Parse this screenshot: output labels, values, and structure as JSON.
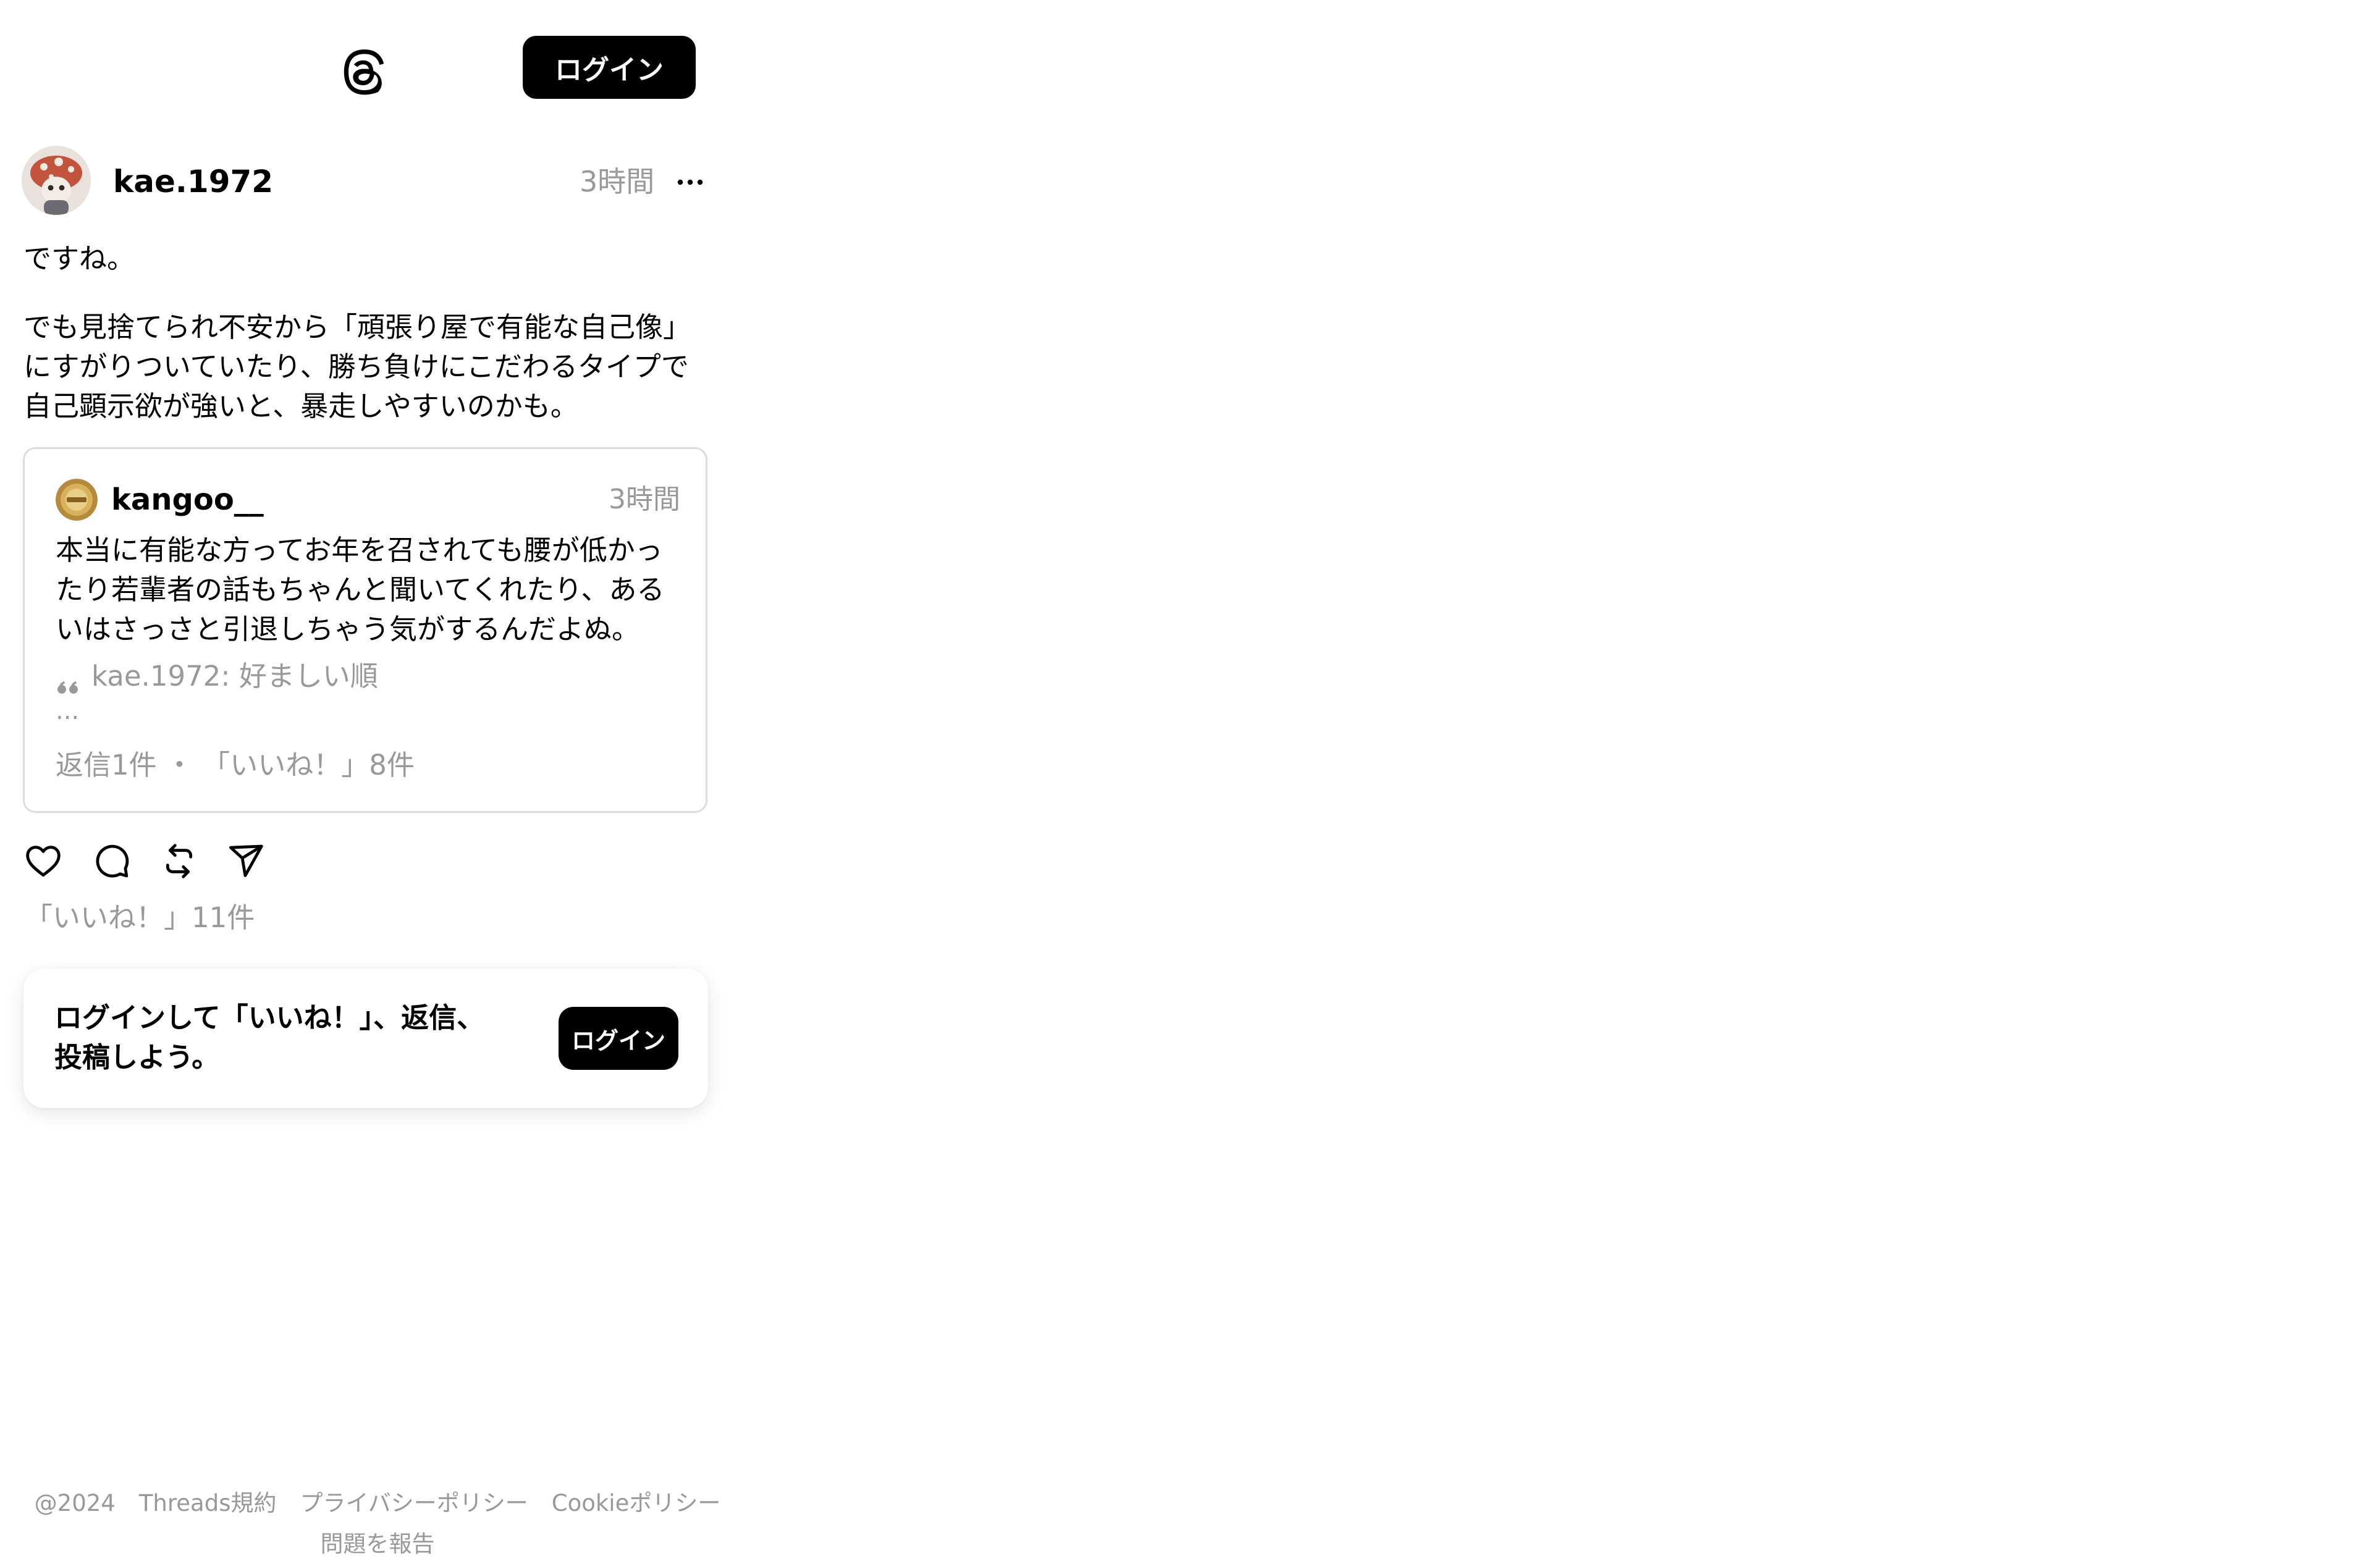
{
  "header": {
    "logo_icon": "threads-logo-icon",
    "login_label": "ログイン"
  },
  "post": {
    "avatar_icon": "mushroom-avatar",
    "username": "kae.1972",
    "time": "3時間",
    "more_icon": "more-horizontal-icon",
    "paragraph1": "ですね。",
    "paragraph2": "でも見捨てられ不安から「頑張り屋で有能な自己像」\nにすがりついていたり、勝ち負けにこだわるタイプで\n自己顕示欲が強いと、暴走しやすいのかも。"
  },
  "quote": {
    "avatar_icon": "badge-avatar",
    "username": "kangoo__",
    "time": "3時間",
    "text": "本当に有能な方ってお年を召されても腰が低かっ\nたり若輩者の話もちゃんと聞いてくれたり、ある\nいはさっさと引退しちゃう気がするんだよぬ。",
    "ref_icon": "quote-marks-icon",
    "ref_text": "kae.1972: 好ましい順",
    "ellipsis": "...",
    "stats": "返信1件 ・ 「いいね！」8件"
  },
  "actions": {
    "like_icon": "heart-icon",
    "reply_icon": "comment-icon",
    "repost_icon": "repost-icon",
    "share_icon": "share-icon",
    "likes": "「いいね！」11件"
  },
  "prompt": {
    "text": "ログインして「いいね！」、返信、\n投稿しよう。",
    "button": "ログイン"
  },
  "footer": {
    "links": [
      "@2024",
      "Threads規約",
      "プライバシーポリシー",
      "Cookieポリシー"
    ],
    "report": "問題を報告"
  }
}
